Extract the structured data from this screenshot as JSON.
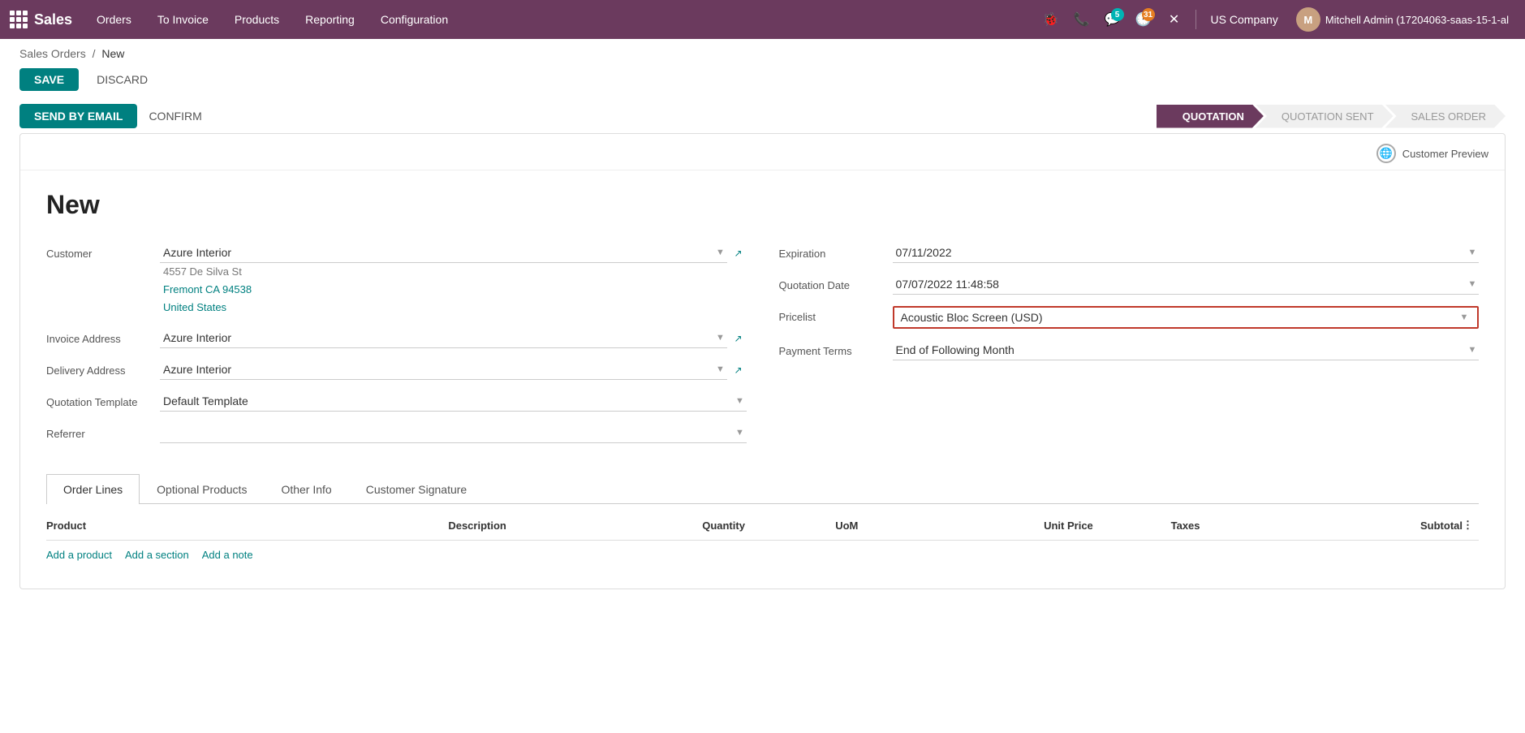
{
  "app": {
    "name": "Sales"
  },
  "topnav": {
    "items": [
      {
        "id": "orders",
        "label": "Orders"
      },
      {
        "id": "to-invoice",
        "label": "To Invoice"
      },
      {
        "id": "products",
        "label": "Products"
      },
      {
        "id": "reporting",
        "label": "Reporting"
      },
      {
        "id": "configuration",
        "label": "Configuration"
      }
    ],
    "icons": {
      "bug_badge": "5",
      "clock_badge": "31"
    },
    "company": "US Company",
    "user": "Mitchell Admin (17204063-saas-15-1-al"
  },
  "breadcrumb": {
    "parent": "Sales Orders",
    "separator": "/",
    "current": "New"
  },
  "actions": {
    "save": "SAVE",
    "discard": "DISCARD",
    "send_email": "SEND BY EMAIL",
    "confirm": "CONFIRM"
  },
  "status_steps": [
    {
      "id": "quotation",
      "label": "QUOTATION",
      "active": true
    },
    {
      "id": "quotation-sent",
      "label": "QUOTATION SENT",
      "active": false
    },
    {
      "id": "sales-order",
      "label": "SALES ORDER",
      "active": false
    }
  ],
  "customer_preview": {
    "label": "Customer Preview"
  },
  "form": {
    "title": "New",
    "left": {
      "customer_label": "Customer",
      "customer_value": "Azure Interior",
      "customer_address1": "4557 De Silva St",
      "customer_address2": "Fremont CA 94538",
      "customer_address3": "United States",
      "invoice_label": "Invoice Address",
      "invoice_value": "Azure Interior",
      "delivery_label": "Delivery Address",
      "delivery_value": "Azure Interior",
      "template_label": "Quotation Template",
      "template_value": "Default Template",
      "referrer_label": "Referrer",
      "referrer_value": ""
    },
    "right": {
      "expiration_label": "Expiration",
      "expiration_value": "07/11/2022",
      "quotation_date_label": "Quotation Date",
      "quotation_date_value": "07/07/2022 11:48:58",
      "pricelist_label": "Pricelist",
      "pricelist_value": "Acoustic Bloc Screen (USD)",
      "payment_terms_label": "Payment Terms",
      "payment_terms_value": "End of Following Month"
    }
  },
  "tabs": [
    {
      "id": "order-lines",
      "label": "Order Lines",
      "active": true
    },
    {
      "id": "optional-products",
      "label": "Optional Products",
      "active": false
    },
    {
      "id": "other-info",
      "label": "Other Info",
      "active": false
    },
    {
      "id": "customer-signature",
      "label": "Customer Signature",
      "active": false
    }
  ],
  "table": {
    "headers": [
      {
        "id": "product",
        "label": "Product"
      },
      {
        "id": "description",
        "label": "Description"
      },
      {
        "id": "quantity",
        "label": "Quantity"
      },
      {
        "id": "uom",
        "label": "UoM"
      },
      {
        "id": "unit-price",
        "label": "Unit Price"
      },
      {
        "id": "taxes",
        "label": "Taxes"
      },
      {
        "id": "subtotal",
        "label": "Subtotal"
      }
    ],
    "add_product": "Add a product",
    "add_section": "Add a section",
    "add_note": "Add a note"
  }
}
